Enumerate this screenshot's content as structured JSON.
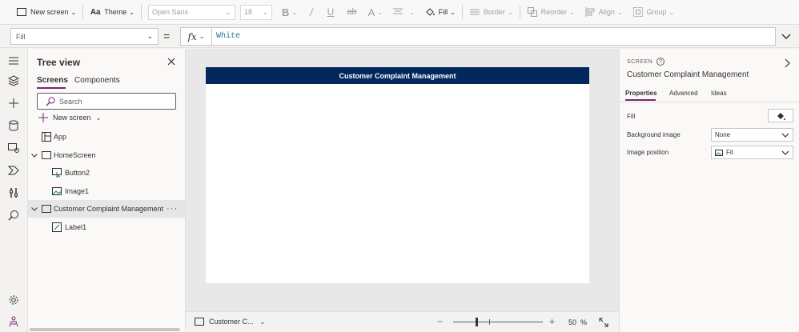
{
  "ribbon": {
    "new_screen": "New screen",
    "theme": "Theme",
    "font_name": "Open Sans",
    "font_size": "18",
    "fill": "Fill",
    "border": "Border",
    "reorder": "Reorder",
    "align": "Align",
    "group": "Group"
  },
  "formula_bar": {
    "property": "Fill",
    "equals": "=",
    "fx": "fx",
    "formula": "White"
  },
  "tree_view": {
    "title": "Tree view",
    "tabs": [
      "Screens",
      "Components"
    ],
    "search_placeholder": "Search",
    "new_screen": "New screen",
    "items": [
      {
        "label": "App"
      },
      {
        "label": "HomeScreen"
      },
      {
        "label": "Button2"
      },
      {
        "label": "Image1"
      },
      {
        "label": "Customer Complaint Management",
        "more": "···"
      },
      {
        "label": "Label1"
      }
    ]
  },
  "canvas": {
    "header_title": "Customer Complaint Management"
  },
  "status_bar": {
    "screen_name": "Customer C...",
    "zoom_value": "50",
    "zoom_unit": "%",
    "zoom_minus": "−",
    "zoom_plus": "+"
  },
  "properties_panel": {
    "kind": "SCREEN",
    "help": "?",
    "name": "Customer Complaint Management",
    "tabs": [
      "Properties",
      "Advanced",
      "Ideas"
    ],
    "fill_label": "Fill",
    "background_image_label": "Background image",
    "background_image_value": "None",
    "image_position_label": "Image position",
    "image_position_value": "Fit"
  },
  "colors": {
    "accent": "#742774",
    "screen_header": "#03285d",
    "formula_text": "#1a7d87"
  }
}
